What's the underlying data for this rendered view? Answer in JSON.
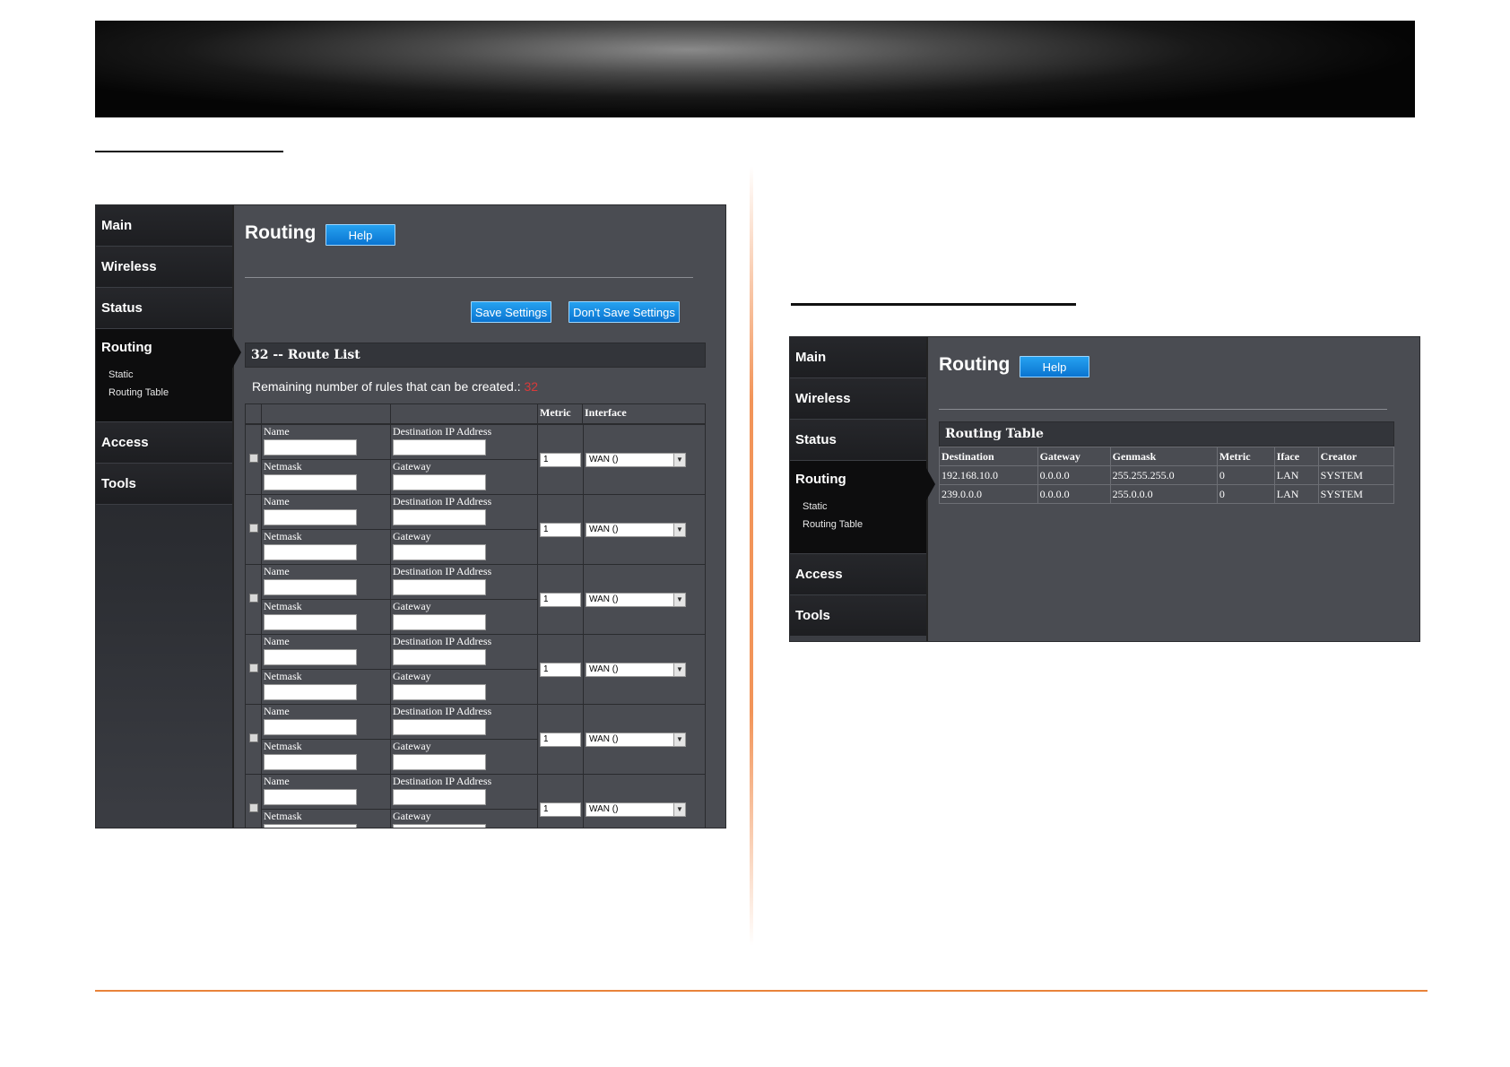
{
  "left_ui": {
    "nav": [
      {
        "label": "Main"
      },
      {
        "label": "Wireless"
      },
      {
        "label": "Status"
      },
      {
        "label": "Routing",
        "sub": [
          "Static",
          "Routing Table"
        ]
      },
      {
        "label": "Access"
      },
      {
        "label": "Tools"
      }
    ],
    "title": "Routing",
    "help": "Help",
    "save": "Save Settings",
    "dont_save": "Don't Save Settings",
    "route_list_title": "32 -- Route List",
    "remaining_label": "Remaining number of rules that can be created.:",
    "remaining_value": "32",
    "headers": {
      "metric": "Metric",
      "interface": "Interface"
    },
    "labels": {
      "name": "Name",
      "dest": "Destination IP Address",
      "netmask": "Netmask",
      "gateway": "Gateway"
    },
    "rows": [
      {
        "metric": "1",
        "interface": "WAN ()"
      },
      {
        "metric": "1",
        "interface": "WAN ()"
      },
      {
        "metric": "1",
        "interface": "WAN ()"
      },
      {
        "metric": "1",
        "interface": "WAN ()"
      },
      {
        "metric": "1",
        "interface": "WAN ()"
      },
      {
        "metric": "1",
        "interface": "WAN ()"
      }
    ]
  },
  "right_ui": {
    "nav": [
      {
        "label": "Main"
      },
      {
        "label": "Wireless"
      },
      {
        "label": "Status"
      },
      {
        "label": "Routing",
        "sub": [
          "Static",
          "Routing Table"
        ]
      },
      {
        "label": "Access"
      },
      {
        "label": "Tools"
      }
    ],
    "title": "Routing",
    "help": "Help",
    "table_title": "Routing Table",
    "columns": [
      "Destination",
      "Gateway",
      "Genmask",
      "Metric",
      "Iface",
      "Creator"
    ],
    "rows": [
      [
        "192.168.10.0",
        "0.0.0.0",
        "255.255.255.0",
        "0",
        "LAN",
        "SYSTEM"
      ],
      [
        "239.0.0.0",
        "0.0.0.0",
        "255.0.0.0",
        "0",
        "LAN",
        "SYSTEM"
      ]
    ]
  }
}
